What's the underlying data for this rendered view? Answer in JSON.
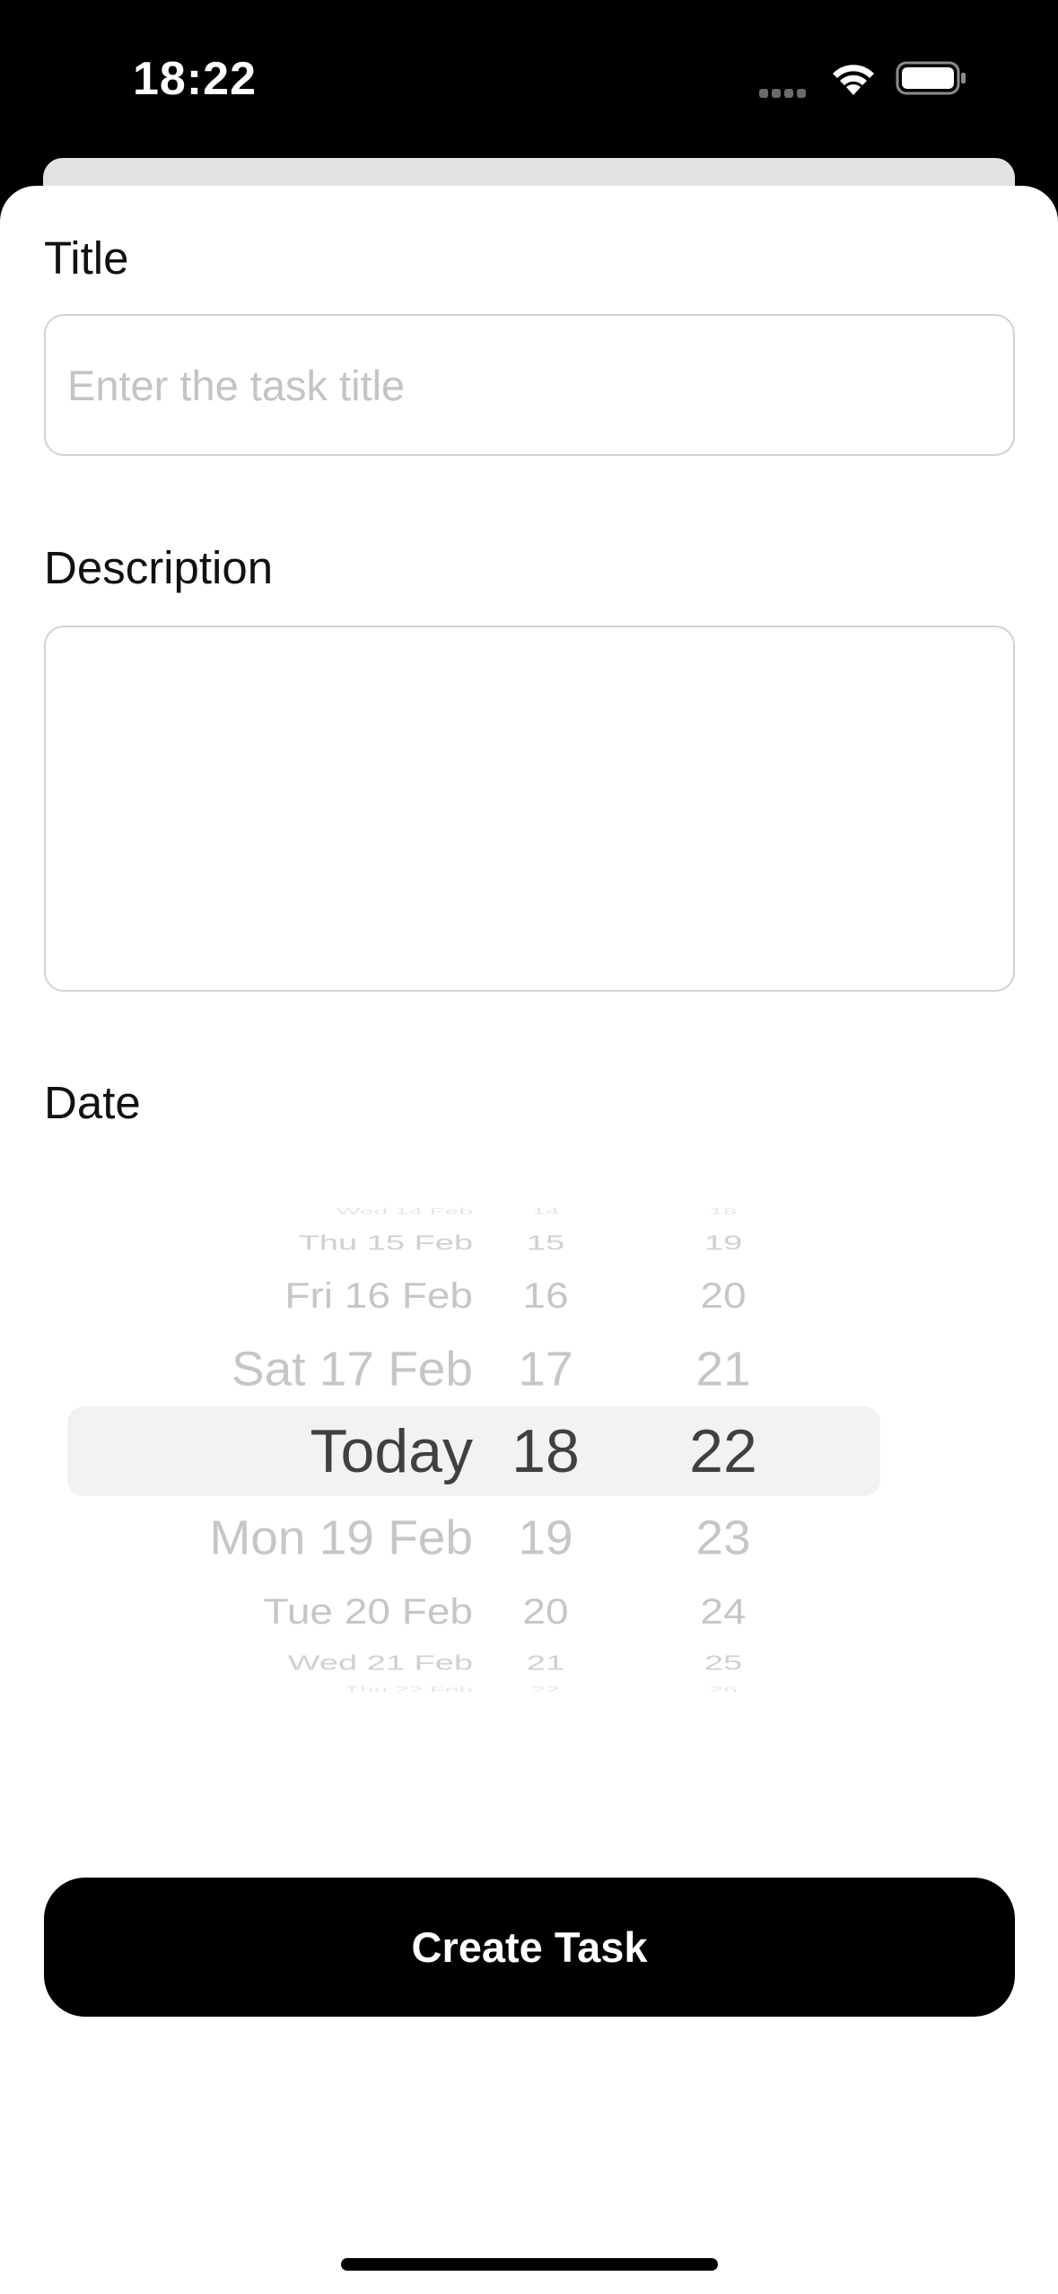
{
  "status_bar": {
    "time": "18:22"
  },
  "form": {
    "title_label": "Title",
    "title_placeholder": "Enter the task title",
    "title_value": "",
    "description_label": "Description",
    "description_value": "",
    "date_label": "Date",
    "create_button_label": "Create Task"
  },
  "date_picker": {
    "dates": [
      "Wed 14 Feb",
      "Thu 15 Feb",
      "Fri 16 Feb",
      "Sat 17 Feb",
      "Today",
      "Mon 19 Feb",
      "Tue 20 Feb",
      "Wed 21 Feb",
      "Thu 22 Feb"
    ],
    "hours": [
      "14",
      "15",
      "16",
      "17",
      "18",
      "19",
      "20",
      "21",
      "22"
    ],
    "minutes": [
      "18",
      "19",
      "20",
      "21",
      "22",
      "23",
      "24",
      "25",
      "26"
    ],
    "selected": {
      "date": "Today",
      "hour": "18",
      "minute": "22"
    }
  },
  "icons": {
    "signal": "cellular-signal-icon",
    "wifi": "wifi-icon",
    "battery": "battery-icon"
  }
}
